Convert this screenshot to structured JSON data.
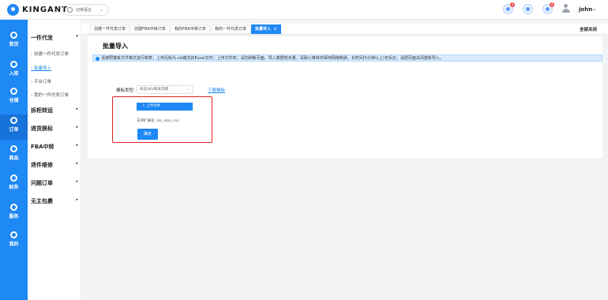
{
  "header": {
    "brand": "KINGANT",
    "language_label": "切换语言",
    "notif_counts": [
      "4",
      "4"
    ],
    "user_name": "john"
  },
  "sidebar": {
    "items": [
      {
        "label": "首页",
        "icon": "dashboard-icon"
      },
      {
        "label": "入库",
        "icon": "inbound-icon"
      },
      {
        "label": "仓储",
        "icon": "warehouse-icon"
      },
      {
        "label": "订单",
        "icon": "order-icon",
        "active": true
      },
      {
        "label": "商品",
        "icon": "product-icon"
      },
      {
        "label": "财务",
        "icon": "finance-icon"
      },
      {
        "label": "服务",
        "icon": "service-icon"
      },
      {
        "label": "我的",
        "icon": "user-icon"
      }
    ]
  },
  "submenu": {
    "group1": "一件代发",
    "sub1": "创建一件代发订单",
    "sub2": "批量导入",
    "sub3": "平台订单",
    "sub4": "我的一件代发订单",
    "groups": [
      "拆柜转运",
      "退货换标",
      "FBA中转",
      "退件维修",
      "问题订单",
      "无主包裹"
    ]
  },
  "tabs": [
    "创建一件代发订单",
    "创建FBA中转订单",
    "我的FBA中转订单",
    "我的一件代发订单",
    "批量导入"
  ],
  "close_all": "全部关闭",
  "page": {
    "title": "批量导入",
    "notice": "请按照模板文件格式进行制表，上传后缀为.xls格式的Excel文件；上传文件时，请勿刷新页面，导入数据较多量，请耐心等待并保持网络畅通，长时间(5分钟以上)无反应，请把页面关闭重新导入。",
    "template_label": "模板类型:",
    "template_value": "商品SKU和发货模",
    "download_link": "下载模板",
    "upload_button": "上传文件",
    "ext_hint": "支持扩展名:.xls,.xlsx,.csv",
    "ok_button": "确定"
  },
  "colors": {
    "primary": "#1e88f5",
    "highlight": "#e02020"
  }
}
